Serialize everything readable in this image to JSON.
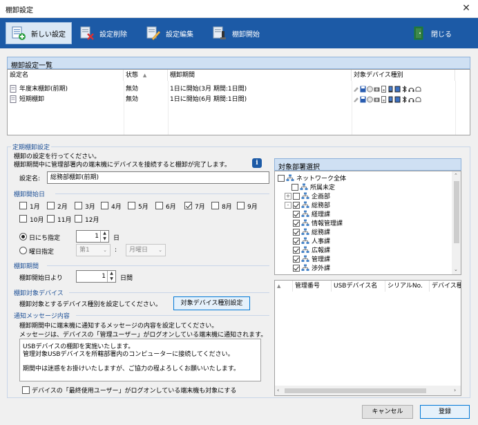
{
  "window": {
    "title": "棚卸設定",
    "close_glyph": "✕"
  },
  "toolbar": {
    "new_label": "新しい設定",
    "delete_label": "設定削除",
    "edit_label": "設定編集",
    "start_label": "棚卸開始",
    "close_label": "閉じる"
  },
  "list": {
    "header": "棚卸設定一覧",
    "columns": [
      "設定名",
      "状態",
      "棚卸期間",
      "対象デバイス種別"
    ],
    "sort_glyph": "▲",
    "rows": [
      {
        "name": "年度末棚卸(前期)",
        "status": "無効",
        "period": "1日に開始(3月 期間:1日間)"
      },
      {
        "name": "短期棚卸",
        "status": "無効",
        "period": "1日に開始(6月 期間:1日間)"
      }
    ]
  },
  "schedule": {
    "group_label": "定期棚卸設定",
    "desc1": "棚卸の設定を行ってください。",
    "desc2": "棚卸期間中に管理部署内の端末機にデバイスを接続すると棚卸が完了します。",
    "info_glyph": "i",
    "name_label": "設定名:",
    "name_value": "総務部棚卸(前期)",
    "start_month_section": "棚卸開始日",
    "months": [
      {
        "label": "1月",
        "checked": false
      },
      {
        "label": "2月",
        "checked": false
      },
      {
        "label": "3月",
        "checked": false
      },
      {
        "label": "4月",
        "checked": false
      },
      {
        "label": "5月",
        "checked": false
      },
      {
        "label": "6月",
        "checked": false
      },
      {
        "label": "7月",
        "checked": true
      },
      {
        "label": "8月",
        "checked": false
      },
      {
        "label": "9月",
        "checked": false
      },
      {
        "label": "10月",
        "checked": false
      },
      {
        "label": "11月",
        "checked": false
      },
      {
        "label": "12月",
        "checked": false
      }
    ],
    "day_radio_label": "日にち指定",
    "day_value": "1",
    "day_unit": "日",
    "weekday_radio_label": "曜日指定",
    "week_select": "第1",
    "colon": ":",
    "weekday_select": "月曜日",
    "period_section": "棚卸期間",
    "period_label": "棚卸開始日より",
    "period_value": "1",
    "period_unit": "日間",
    "device_section": "棚卸対象デバイス",
    "device_desc": "棚卸対象とするデバイス種別を設定してください。",
    "device_button": "対象デバイス種別設定",
    "notify_section": "通知メッセージ内容",
    "notify_desc1": "棚卸期間中に端末機に通知するメッセージの内容を設定してください。",
    "notify_desc2": "メッセージは、デバイスの「管理ユーザー」がログオンしている端末機に通知されます。",
    "message_line1": "USBデバイスの棚卸を実施いたします。",
    "message_line2": "管理対象USBデバイスを所轄部署内のコンピューターに接続してください。",
    "message_line3": "期間中は迷惑をお掛けいたしますが、ご協力の程よろしくお願いいたします。",
    "last_user_label": "デバイスの「最終使用ユーザー」がログオンしている端末機も対象にする"
  },
  "dept": {
    "header": "対象部署選択",
    "items": [
      {
        "label": "ネットワーク全体",
        "level": 0,
        "checked": false,
        "expander": ""
      },
      {
        "label": "所属未定",
        "level": 1,
        "checked": false,
        "expander": ""
      },
      {
        "label": "企画部",
        "level": 1,
        "checked": false,
        "expander": "+"
      },
      {
        "label": "総務部",
        "level": 1,
        "checked": true,
        "expander": "-"
      },
      {
        "label": "経理課",
        "level": 2,
        "checked": true,
        "expander": ""
      },
      {
        "label": "情報管理課",
        "level": 2,
        "checked": true,
        "expander": ""
      },
      {
        "label": "総務課",
        "level": 2,
        "checked": true,
        "expander": ""
      },
      {
        "label": "人事課",
        "level": 2,
        "checked": true,
        "expander": ""
      },
      {
        "label": "広報課",
        "level": 2,
        "checked": true,
        "expander": ""
      },
      {
        "label": "管理課",
        "level": 2,
        "checked": true,
        "expander": ""
      },
      {
        "label": "渉外課",
        "level": 2,
        "checked": true,
        "expander": ""
      }
    ]
  },
  "usb_table": {
    "sort_glyph": "▲",
    "columns": [
      "管理番号",
      "USBデバイス名",
      "シリアルNo.",
      "デバイス種"
    ]
  },
  "footer": {
    "cancel_label": "キャンセル",
    "register_label": "登録"
  },
  "colors": {
    "toolbar": "#1c5aa6",
    "section_text": "#1c4f96",
    "panel_head": "#cfe0f3"
  }
}
